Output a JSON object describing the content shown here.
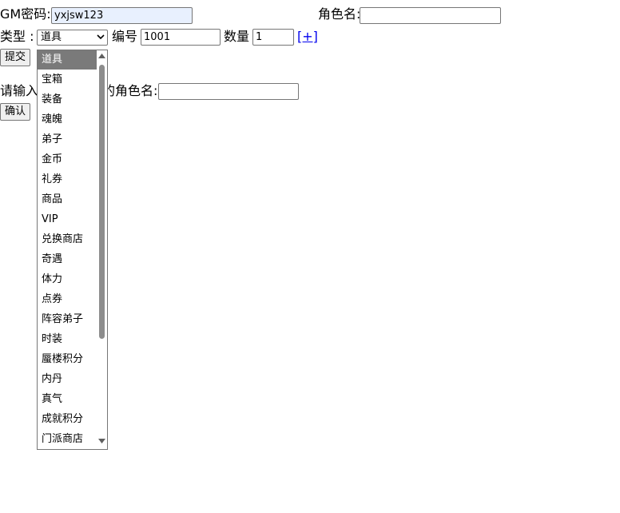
{
  "row1": {
    "gm_label": "GM密码:",
    "gm_value": "yxjsw123",
    "role_label": "角色名:",
    "role_value": ""
  },
  "row2": {
    "type_label": "类型 :",
    "type_selected": "道具",
    "id_label": "编号",
    "id_value": "1001",
    "qty_label": "数量",
    "qty_value": "1",
    "add_link": "[+]"
  },
  "submit_label": "提交",
  "row3": {
    "prompt_left": "请输入",
    "prompt_right": "的角色名:",
    "role2_value": ""
  },
  "confirm_label": "确认",
  "dropdown": {
    "options": [
      "道具",
      "宝箱",
      "装备",
      "魂魄",
      "弟子",
      "金币",
      "礼券",
      "商品",
      "VIP",
      "兑换商店",
      "奇遇",
      "体力",
      "点券",
      "阵容弟子",
      "时装",
      "蜃楼积分",
      "内丹",
      "真气",
      "成就积分",
      "门派商店"
    ],
    "selected_index": 0
  }
}
